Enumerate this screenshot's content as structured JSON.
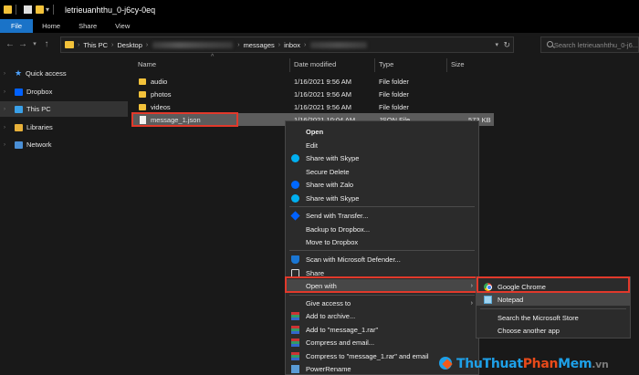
{
  "window": {
    "title": "letrieuanhthu_0-j6cy-0eq"
  },
  "ribbon": {
    "tabs": [
      "File",
      "Home",
      "Share",
      "View"
    ]
  },
  "address": {
    "crumbs": [
      "This PC",
      "Desktop",
      "messages",
      "inbox"
    ],
    "search_placeholder": "Search letrieuanhthu_0-j6..."
  },
  "sidebar": {
    "items": [
      {
        "label": "Quick access",
        "icon": "star-icon"
      },
      {
        "label": "Dropbox",
        "icon": "dropbox-icon"
      },
      {
        "label": "This PC",
        "icon": "pc-icon"
      },
      {
        "label": "Libraries",
        "icon": "libraries-icon"
      },
      {
        "label": "Network",
        "icon": "network-icon"
      }
    ]
  },
  "columns": {
    "name": "Name",
    "date": "Date modified",
    "type": "Type",
    "size": "Size"
  },
  "files": [
    {
      "name": "audio",
      "date": "1/16/2021 9:56 AM",
      "type": "File folder",
      "size": ""
    },
    {
      "name": "photos",
      "date": "1/16/2021 9:56 AM",
      "type": "File folder",
      "size": ""
    },
    {
      "name": "videos",
      "date": "1/16/2021 9:56 AM",
      "type": "File folder",
      "size": ""
    },
    {
      "name": "message_1.json",
      "date": "1/16/2021 10:04 AM",
      "type": "JSON File",
      "size": "573 KB"
    }
  ],
  "context_menu": {
    "open": "Open",
    "edit": "Edit",
    "share_skype_1": "Share with Skype",
    "secure_delete": "Secure Delete",
    "share_zalo": "Share with Zalo",
    "share_skype_2": "Share with Skype",
    "send_transfer": "Send with Transfer...",
    "backup_dropbox": "Backup to Dropbox...",
    "move_dropbox": "Move to Dropbox",
    "scan_defender": "Scan with Microsoft Defender...",
    "share": "Share",
    "open_with": "Open with",
    "give_access": "Give access to",
    "add_archive": "Add to archive...",
    "add_rar": "Add to \"message_1.rar\"",
    "compress_email": "Compress and email...",
    "compress_rar_email": "Compress to \"message_1.rar\" and email",
    "power_rename": "PowerRename"
  },
  "submenu": {
    "chrome": "Google Chrome",
    "notepad": "Notepad",
    "store": "Search the Microsoft Store",
    "another": "Choose another app"
  },
  "watermark": {
    "part1": "Thu",
    "part2": "Thuat",
    "part3": "Phan",
    "part4": "Mem",
    "part5": ".vn"
  },
  "colors": {
    "accent": "#1a73c8",
    "highlight": "#e1392b",
    "folder": "#f3c23a"
  }
}
